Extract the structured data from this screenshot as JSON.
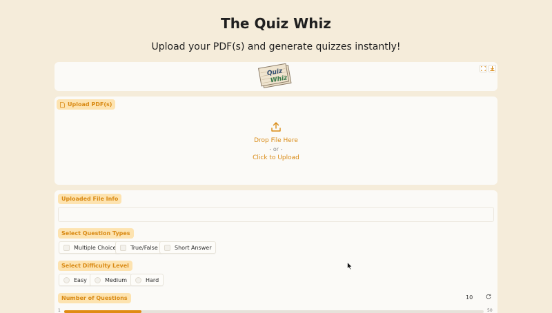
{
  "header": {
    "title": "The Quiz Whiz",
    "subtitle": "Upload your PDF(s) and generate quizzes instantly!"
  },
  "logo": {
    "line1": "Quiz",
    "line2": "Whiz"
  },
  "upload": {
    "label": "Upload PDF(s)",
    "drop_text": "Drop File Here",
    "or_text": "- or -",
    "click_text": "Click to Upload"
  },
  "file_info": {
    "label": "Uploaded File Info",
    "value": ""
  },
  "question_types": {
    "label": "Select Question Types",
    "options": [
      "Multiple Choice",
      "True/False",
      "Short Answer"
    ]
  },
  "difficulty": {
    "label": "Select Difficulty Level",
    "options": [
      "Easy",
      "Medium",
      "Hard"
    ]
  },
  "num_questions": {
    "label": "Number of Questions",
    "value": "10",
    "min": "1",
    "max": "50",
    "fraction": 0.184
  },
  "colors": {
    "accent": "#e08b12",
    "label_bg": "#fde3b0",
    "page_bg": "#f5ecda"
  }
}
